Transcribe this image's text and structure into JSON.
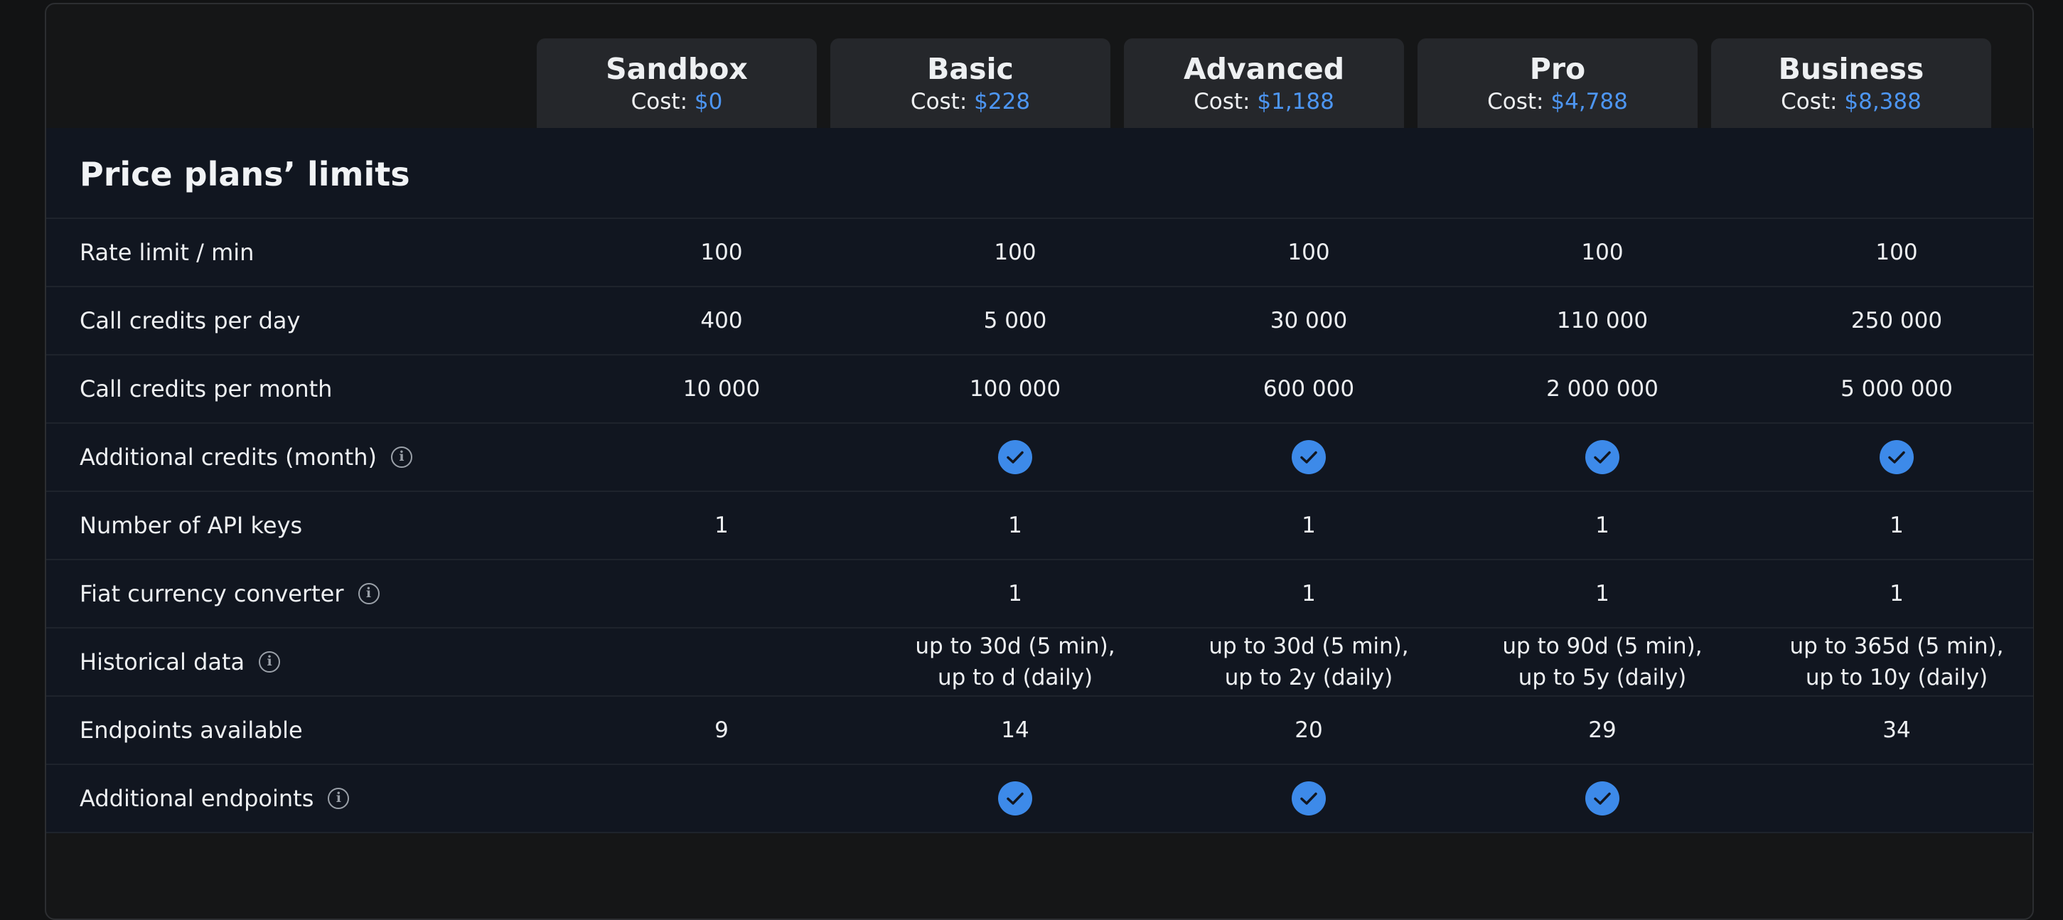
{
  "plans": [
    {
      "name": "Sandbox",
      "cost_label": "Cost:",
      "price": "$0"
    },
    {
      "name": "Basic",
      "cost_label": "Cost:",
      "price": "$228"
    },
    {
      "name": "Advanced",
      "cost_label": "Cost:",
      "price": "$1,188"
    },
    {
      "name": "Pro",
      "cost_label": "Cost:",
      "price": "$4,788"
    },
    {
      "name": "Business",
      "cost_label": "Cost:",
      "price": "$8,388"
    }
  ],
  "section_title": "Price plans’ limits",
  "rows": [
    {
      "label": "Rate limit / min",
      "has_info": false,
      "values": [
        "100",
        "100",
        "100",
        "100",
        "100"
      ]
    },
    {
      "label": "Call credits per day",
      "has_info": false,
      "values": [
        "400",
        "5 000",
        "30 000",
        "110 000",
        "250 000"
      ]
    },
    {
      "label": "Call credits per month",
      "has_info": false,
      "values": [
        "10 000",
        "100 000",
        "600 000",
        "2 000 000",
        "5 000 000"
      ]
    },
    {
      "label": "Additional credits (month)",
      "has_info": true,
      "values": [
        null,
        "check",
        "check",
        "check",
        "check"
      ]
    },
    {
      "label": "Number of API keys",
      "has_info": false,
      "values": [
        "1",
        "1",
        "1",
        "1",
        "1"
      ]
    },
    {
      "label": "Fiat currency converter",
      "has_info": true,
      "values": [
        null,
        "1",
        "1",
        "1",
        "1"
      ]
    },
    {
      "label": "Historical data",
      "has_info": true,
      "values": [
        null,
        [
          "up to 30d (5 min),",
          "up to d (daily)"
        ],
        [
          "up to 30d (5 min),",
          "up to 2y (daily)"
        ],
        [
          "up to 90d (5 min),",
          "up to 5y (daily)"
        ],
        [
          "up to 365d (5 min),",
          "up to 10y (daily)"
        ]
      ]
    },
    {
      "label": "Endpoints available",
      "has_info": false,
      "values": [
        "9",
        "14",
        "20",
        "29",
        "34"
      ]
    },
    {
      "label": "Additional endpoints",
      "has_info": true,
      "values": [
        null,
        "check",
        "check",
        "check",
        null
      ]
    }
  ],
  "icons": {
    "info": "info-icon",
    "check": "check-circle-icon"
  },
  "colors": {
    "accent": "#4d96f3",
    "check_fill": "#3d8ae9",
    "table_bg": "#111620",
    "header_bg": "#25272b"
  }
}
